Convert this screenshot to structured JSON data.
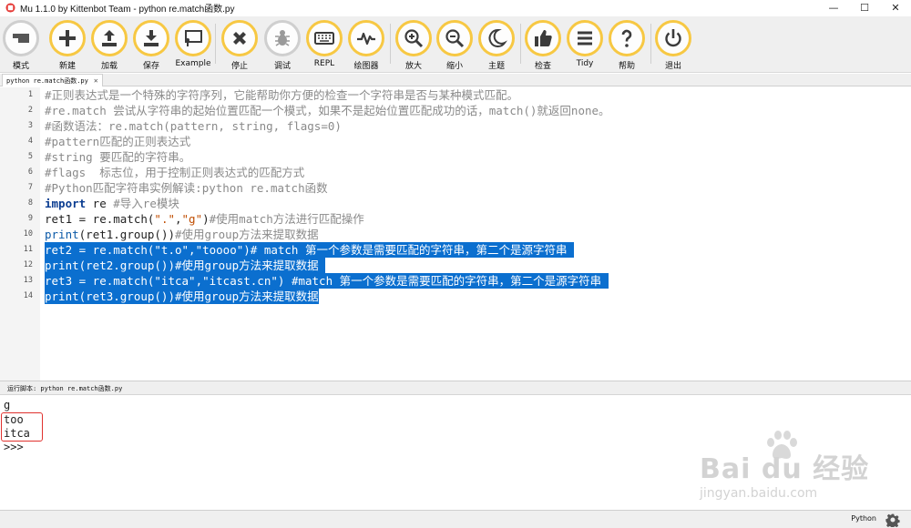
{
  "window": {
    "title": "Mu 1.1.0 by Kittenbot Team - python re.match函数.py",
    "minimize": "—",
    "maximize": "☐",
    "close": "✕"
  },
  "toolbar": {
    "mode": "模式",
    "new": "新建",
    "load": "加载",
    "save": "保存",
    "example": "Example",
    "stop": "停止",
    "debug": "调试",
    "repl": "REPL",
    "plotter": "绘图器",
    "zoom_in": "放大",
    "zoom_out": "缩小",
    "theme": "主题",
    "check": "检查",
    "tidy": "Tidy",
    "help": "帮助",
    "quit": "退出"
  },
  "tab": {
    "filename": "python re.match函数.py",
    "close": "✕"
  },
  "editor": {
    "line_numbers": [
      "1",
      "2",
      "3",
      "4",
      "5",
      "6",
      "7",
      "8",
      "9",
      "10",
      "11",
      "12",
      "13",
      "14"
    ],
    "comments": {
      "l1": "#正则表达式是一个特殊的字符序列，它能帮助你方便的检查一个字符串是否与某种模式匹配。",
      "l2": "#re.match 尝试从字符串的起始位置匹配一个模式，如果不是起始位置匹配成功的话，match()就返回none。",
      "l3": "#函数语法：re.match(pattern, string, flags=0)",
      "l4": "#pattern匹配的正则表达式",
      "l5": "#string 要匹配的字符串。",
      "l6": "#flags  标志位，用于控制正则表达式的匹配方式",
      "l7": "#Python匹配字符串实例解读:python re.match函数",
      "l8": "#导入re模块",
      "l9": "#使用match方法进行匹配操作",
      "l10": "#使用group方法来提取数据",
      "l11": "# match 第一个参数是需要匹配的字符串，第二个是源字符串 ",
      "l12": "#使用group方法来提取数据 ",
      "l13": "#match 第一个参数是需要匹配的字符串，第二个是源字符串 ",
      "l14": "#使用group方法来提取数据"
    },
    "code": {
      "l8_kw": "import",
      "l8_rest": " re ",
      "l9_pre": "ret1 = re.match(",
      "l9_s1": "\".\"",
      "l9_comma": ",",
      "l9_s2": "\"g\"",
      "l9_close": ")",
      "l10_fn": "print",
      "l10_rest": "(ret1.group())",
      "l11_code": "ret2 = re.match(\"t.o\",\"toooo\")",
      "l12_code": "print(ret2.group())",
      "l13_code": "ret3 = re.match(\"itca\",\"itcast.cn\") ",
      "l14_code": "print(ret3.group())"
    }
  },
  "run": {
    "label": "运行脚本: python re.match函数.py"
  },
  "output": {
    "lines": [
      "g",
      "too",
      "itca",
      ">>>"
    ]
  },
  "watermark": {
    "brand": "Bai du 经验",
    "url": "jingyan.baidu.com"
  },
  "status": {
    "mode": "Python"
  },
  "colors": {
    "accent_ring": "#f7c843",
    "selection": "#0b6fcf",
    "highlight_box": "#e0312e"
  }
}
